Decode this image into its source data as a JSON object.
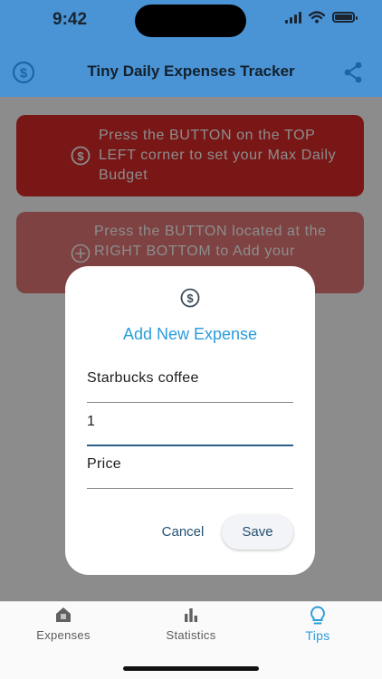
{
  "status_bar": {
    "time": "9:42"
  },
  "app_bar": {
    "title": "Tiny Daily Expenses Tracker",
    "left_icon": "dollar-circle-icon",
    "right_icon": "share-icon",
    "color": "#4a94d6"
  },
  "tips": [
    {
      "icon": "dollar-circle-icon",
      "text": "Press the BUTTON on the TOP LEFT corner to set your Max Daily Budget",
      "color": "#dd2b2a"
    },
    {
      "icon": "plus-circle-icon",
      "text": "Press the BUTTON located at the RIGHT BOTTOM to Add your",
      "color": "#e77978"
    }
  ],
  "dialog": {
    "icon": "dollar-circle-icon",
    "title": "Add New Expense",
    "fields": [
      {
        "value": "Starbucks coffee"
      },
      {
        "value": "1"
      },
      {
        "value": "Price"
      }
    ],
    "cancel_label": "Cancel",
    "save_label": "Save",
    "accent": "#2a9ddb"
  },
  "bottom_nav": {
    "items": [
      {
        "label": "Expenses",
        "icon": "home-icon"
      },
      {
        "label": "Statistics",
        "icon": "bar-chart-icon"
      },
      {
        "label": "Tips",
        "icon": "lightbulb-icon",
        "active": true
      }
    ]
  }
}
